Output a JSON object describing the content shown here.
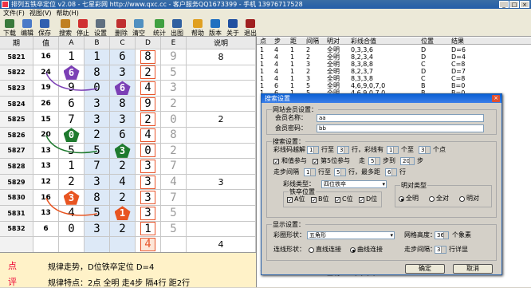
{
  "window": {
    "title": "排列五铁卒定位 v2.08 - 七星彩网 http://www.qxc.cc - 客户服务QQ1673399 - 手机 13976717528"
  },
  "menu": [
    "文件(F)",
    "视图(V)",
    "帮助(H)"
  ],
  "toolbar": [
    {
      "label": "下载",
      "icon": "download-icon",
      "color": "#3a7a3a"
    },
    {
      "label": "编辑",
      "icon": "edit-icon",
      "color": "#4a7ac8"
    },
    {
      "label": "保存",
      "icon": "save-icon",
      "color": "#3060b0"
    },
    {
      "label": "搜索",
      "icon": "search-icon",
      "color": "#c08020"
    },
    {
      "label": "停止",
      "icon": "stop-icon",
      "color": "#d03030"
    },
    {
      "label": "设置",
      "icon": "settings-icon",
      "color": "#607080"
    },
    {
      "label": "删除",
      "icon": "delete-icon",
      "color": "#c03030"
    },
    {
      "label": "清空",
      "icon": "clear-icon",
      "color": "#5090c0"
    },
    {
      "label": "统计",
      "icon": "stats-icon",
      "color": "#40a040"
    },
    {
      "label": "出图",
      "icon": "chart-icon",
      "color": "#3060a0"
    },
    {
      "label": "帮助",
      "icon": "help-icon",
      "color": "#e0a020"
    },
    {
      "label": "版本",
      "icon": "version-icon",
      "color": "#2070c0"
    },
    {
      "label": "关于",
      "icon": "about-icon",
      "color": "#2050a0"
    },
    {
      "label": "退出",
      "icon": "exit-icon",
      "color": "#a02020"
    }
  ],
  "grid": {
    "headers": [
      "期",
      "值",
      "A",
      "B",
      "C",
      "D",
      "E",
      "说明"
    ],
    "rows": [
      {
        "qi": "5821",
        "zhi": "16",
        "a": "1",
        "b": "1",
        "c": "6",
        "d": "8",
        "e": "9",
        "expl": "8"
      },
      {
        "qi": "5822",
        "zhi": "24",
        "a": "6",
        "b": "8",
        "c": "3",
        "d": "2",
        "e": "5",
        "expl": ""
      },
      {
        "qi": "5823",
        "zhi": "19",
        "a": "9",
        "b": "0",
        "c": "6",
        "d": "4",
        "e": "3",
        "expl": ""
      },
      {
        "qi": "5824",
        "zhi": "26",
        "a": "6",
        "b": "3",
        "c": "8",
        "d": "9",
        "e": "2",
        "expl": ""
      },
      {
        "qi": "5825",
        "zhi": "15",
        "a": "7",
        "b": "3",
        "c": "3",
        "d": "2",
        "e": "0",
        "expl": "2"
      },
      {
        "qi": "5826",
        "zhi": "20",
        "a": "0",
        "b": "2",
        "c": "6",
        "d": "4",
        "e": "8",
        "expl": ""
      },
      {
        "qi": "5827",
        "zhi": "13",
        "a": "5",
        "b": "5",
        "c": "3",
        "d": "0",
        "e": "2",
        "expl": ""
      },
      {
        "qi": "5828",
        "zhi": "13",
        "a": "1",
        "b": "7",
        "c": "2",
        "d": "3",
        "e": "7",
        "expl": ""
      },
      {
        "qi": "5829",
        "zhi": "12",
        "a": "2",
        "b": "3",
        "c": "4",
        "d": "3",
        "e": "4",
        "expl": "3"
      },
      {
        "qi": "5830",
        "zhi": "16",
        "a": "3",
        "b": "8",
        "c": "2",
        "d": "3",
        "e": "7",
        "expl": ""
      },
      {
        "qi": "5831",
        "zhi": "13",
        "a": "4",
        "b": "5",
        "c": "1",
        "d": "3",
        "e": "5",
        "expl": ""
      },
      {
        "qi": "5832",
        "zhi": "6",
        "a": "0",
        "b": "3",
        "c": "2",
        "d": "1",
        "e": "5",
        "expl": ""
      },
      {
        "qi": "",
        "zhi": "",
        "a": "",
        "b": "",
        "c": "",
        "d": "4",
        "e": "",
        "expl": "4"
      }
    ],
    "markers": [
      {
        "row": 1,
        "col": "a",
        "value": "6",
        "color": "#7b3fb5"
      },
      {
        "row": 2,
        "col": "c",
        "value": "6",
        "color": "#7b3fb5"
      },
      {
        "row": 5,
        "col": "a",
        "value": "0",
        "color": "#1e7a2e"
      },
      {
        "row": 6,
        "col": "c",
        "value": "3",
        "color": "#1e7a2e"
      },
      {
        "row": 9,
        "col": "a",
        "value": "3",
        "color": "#e85522"
      },
      {
        "row": 10,
        "col": "c",
        "value": "1",
        "color": "#e85522"
      }
    ]
  },
  "footer": {
    "label1": "点",
    "text1": "规律走势，D位铁卒定位 D=4",
    "label2": "评",
    "text2": "规律特点：2点 全明 走4步 隔4行 距2行"
  },
  "results": {
    "headers": [
      "点",
      "步",
      "距",
      "间隔",
      "明对",
      "彩线合值",
      "位置",
      "结果"
    ],
    "rows": [
      [
        "1",
        "4",
        "1",
        "2",
        "全明",
        "0,3,3,6",
        "D",
        "D=6"
      ],
      [
        "1",
        "4",
        "1",
        "2",
        "全明",
        "8,2,3,4",
        "D",
        "D=4"
      ],
      [
        "1",
        "4",
        "1",
        "3",
        "全明",
        "8,3,8,8",
        "C",
        "C=8"
      ],
      [
        "1",
        "4",
        "1",
        "2",
        "全明",
        "8,2,3,7",
        "D",
        "D=7"
      ],
      [
        "1",
        "4",
        "1",
        "3",
        "全明",
        "8,3,3,8",
        "C",
        "C=8"
      ],
      [
        "1",
        "6",
        "1",
        "5",
        "全明",
        "4,6,9,0,7,0",
        "B",
        "B=0"
      ],
      [
        "1",
        "6",
        "1",
        "5",
        "全明",
        "4,6,9,0,7,0",
        "B",
        "B=0"
      ]
    ],
    "tail": [
      [
        "1",
        "5",
        "1",
        "1",
        "全明",
        "7,2,8,6,7",
        "D",
        "D=8"
      ],
      [
        "",
        "",
        "",
        "",
        "",
        "",
        "",
        ""
      ]
    ]
  },
  "dialog": {
    "title": "搜索设置",
    "member_group": "网站会员设置：",
    "member_name_label": "会员名称：",
    "member_name": "aa",
    "member_pass_label": "会员密码：",
    "member_pass": "bb",
    "search_group": "搜索设置：",
    "row1": {
      "a": "彩线码越解",
      "v1": "1",
      "b": "行至",
      "v2": "3",
      "c": "行，彩线有",
      "v3": "1",
      "d": "个至",
      "v4": "3",
      "e": "个点"
    },
    "row2": {
      "c1": "和值参与",
      "c2": "第5位参与",
      "a": "走",
      "v1": "5",
      "b": "步到",
      "v2": "20",
      "c": "步"
    },
    "row3": {
      "a": "走步间隔",
      "v1": "1",
      "b": "行至",
      "v2": "5",
      "c": "行，最多距",
      "v3": "6",
      "d": "行"
    },
    "type_label": "彩线类型：",
    "type_value": "四位铁卒",
    "pos_group": "铁卒位置",
    "positions": [
      "A位",
      "B位",
      "C位",
      "D位"
    ],
    "pair_group": "明对类型",
    "pairs": [
      "全明",
      "全对",
      "明对"
    ],
    "display_group": "显示设置：",
    "shape_label": "彩圈形状：",
    "shape_value": "五角形",
    "grid_h_label": "网格高度：",
    "grid_h_value": "36",
    "grid_h_unit": "个象素",
    "line_label": "连线形状：",
    "line_opt1": "直线连接",
    "line_opt2": "曲线连接",
    "step_gap_label": "走步间隔：",
    "step_gap_value": "3",
    "step_gap_unit": "行详显",
    "ok": "确定",
    "cancel": "取消"
  }
}
